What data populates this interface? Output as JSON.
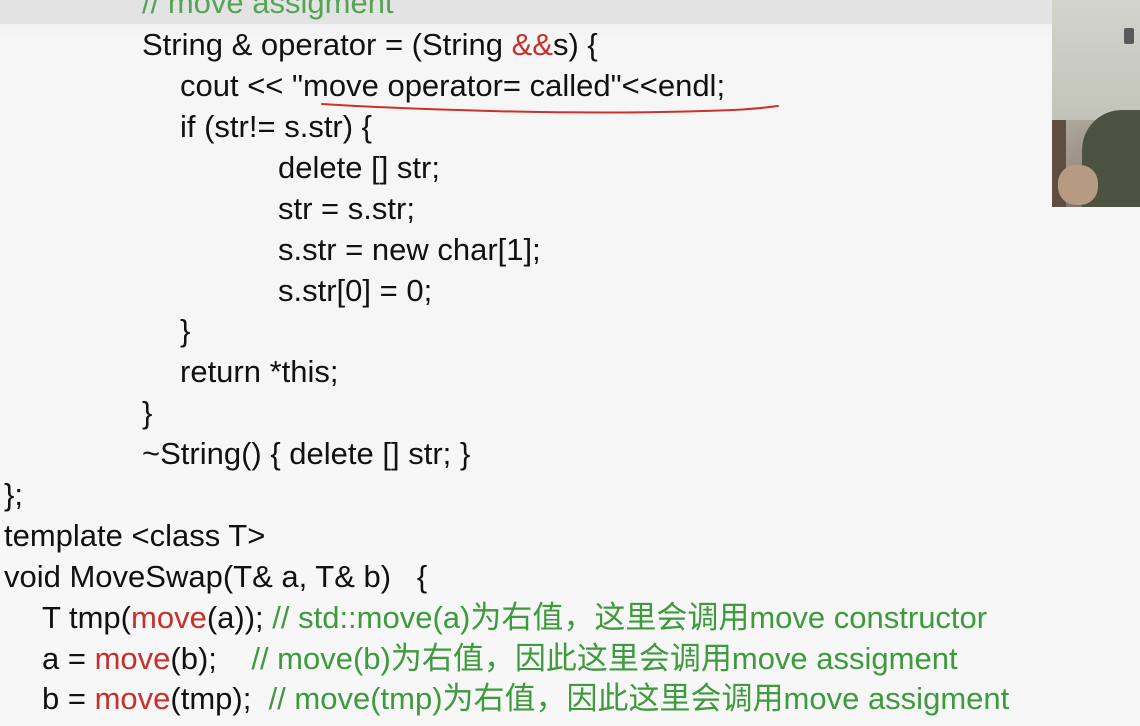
{
  "code": {
    "line_top_comment": "// move assigment",
    "line_sig_a": "String & operator = (String ",
    "line_sig_b": "&&",
    "line_sig_c": "s) {",
    "line_cout": "cout << \"move operator= called\"<<endl;",
    "line_if": "if (str!= s.str) {",
    "line_delete": "delete [] str;",
    "line_assign": "str = s.str;",
    "line_new": "s.str = new char[1];",
    "line_zero": "s.str[0] = 0;",
    "line_close_if": "}",
    "line_return": "return *this;",
    "line_close_fn": "}",
    "line_dtor": "~String() { delete [] str; }",
    "line_close_class": "};",
    "line_template": "template <class T>",
    "line_moveswap": "void MoveSwap(T& a, T& b)   {",
    "line_tmp_a": "T tmp(",
    "line_tmp_b": "move",
    "line_tmp_c": "(a)); ",
    "line_tmp_comment": "// std::move(a)为右值，这里会调用move constructor",
    "line_a_a": "a = ",
    "line_a_b": "move",
    "line_a_c": "(b);    ",
    "line_a_comment": "// move(b)为右值，因此这里会调用move assigment",
    "line_b_a": "b = ",
    "line_b_b": "move",
    "line_b_c": "(tmp);  ",
    "line_b_comment": "// move(tmp)为右值，因此这里会调用move assigment"
  },
  "colors": {
    "keyword_red": "#c8302b",
    "comment_green": "#3d9a3d",
    "annotation_red": "#d0302a"
  }
}
